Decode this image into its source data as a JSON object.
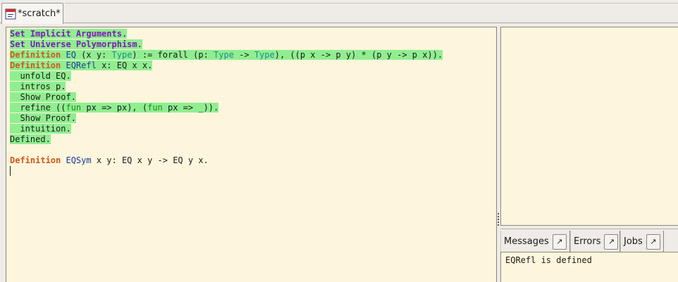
{
  "tabbar": {
    "tabs": [
      {
        "label": "*scratch*",
        "icon": "document-icon"
      }
    ]
  },
  "editor": {
    "lines": [
      {
        "segments": [
          {
            "text": "Set Implicit Arguments",
            "cls": "kw-set"
          },
          {
            "text": "."
          }
        ],
        "highlighted": true
      },
      {
        "segments": [
          {
            "text": "Set Universe Polymorphism",
            "cls": "kw-set"
          },
          {
            "text": "."
          }
        ],
        "highlighted": true
      },
      {
        "segments": [
          {
            "text": "Definition",
            "cls": "kw-def"
          },
          {
            "text": " "
          },
          {
            "text": "EQ",
            "cls": "ident"
          },
          {
            "text": " (x y: "
          },
          {
            "text": "Type",
            "cls": "type"
          },
          {
            "text": ") := forall (p: "
          },
          {
            "text": "Type",
            "cls": "type"
          },
          {
            "text": " -> "
          },
          {
            "text": "Type",
            "cls": "type"
          },
          {
            "text": "), ((p x -> p y) * (p y -> p x))."
          }
        ],
        "highlighted": true
      },
      {
        "segments": [
          {
            "text": "Definition",
            "cls": "kw-def"
          },
          {
            "text": " "
          },
          {
            "text": "EQRefl",
            "cls": "ident"
          },
          {
            "text": " x: EQ x x."
          }
        ],
        "highlighted": true
      },
      {
        "segments": [
          {
            "text": "  unfold EQ."
          }
        ],
        "highlighted": true
      },
      {
        "segments": [
          {
            "text": "  intros p."
          }
        ],
        "highlighted": true
      },
      {
        "segments": [
          {
            "text": "  Show Proof."
          }
        ],
        "highlighted": true
      },
      {
        "segments": [
          {
            "text": "  refine (("
          },
          {
            "text": "fun",
            "cls": "fun"
          },
          {
            "text": " px => px), ("
          },
          {
            "text": "fun",
            "cls": "fun"
          },
          {
            "text": " px => _))."
          }
        ],
        "highlighted": true
      },
      {
        "segments": [
          {
            "text": "  Show Proof."
          }
        ],
        "highlighted": true
      },
      {
        "segments": [
          {
            "text": "  intuition."
          }
        ],
        "highlighted": true
      },
      {
        "segments": [
          {
            "text": "Defined."
          }
        ],
        "highlighted": true
      },
      {
        "segments": [
          {
            "text": ""
          }
        ],
        "highlighted": false
      },
      {
        "segments": [
          {
            "text": "Definition",
            "cls": "kw-def"
          },
          {
            "text": " "
          },
          {
            "text": "EQSym",
            "cls": "ident"
          },
          {
            "text": " x y: EQ x y -> EQ y x."
          }
        ],
        "highlighted": false
      }
    ]
  },
  "message_tabs": [
    {
      "label": "Messages",
      "detach_glyph": "↗"
    },
    {
      "label": "Errors",
      "detach_glyph": "↗"
    },
    {
      "label": "Jobs",
      "detach_glyph": "↗"
    }
  ],
  "messages": {
    "text": "EQRefl is defined"
  },
  "colors": {
    "processed_highlight": "#90ee90",
    "editor_background": "#fdf6dc",
    "keyword_set": "#7d1ab8",
    "keyword_definition": "#d2561a",
    "identifier": "#1a3a9f",
    "type": "#1a8f8f",
    "fun": "#1a8f1a"
  }
}
